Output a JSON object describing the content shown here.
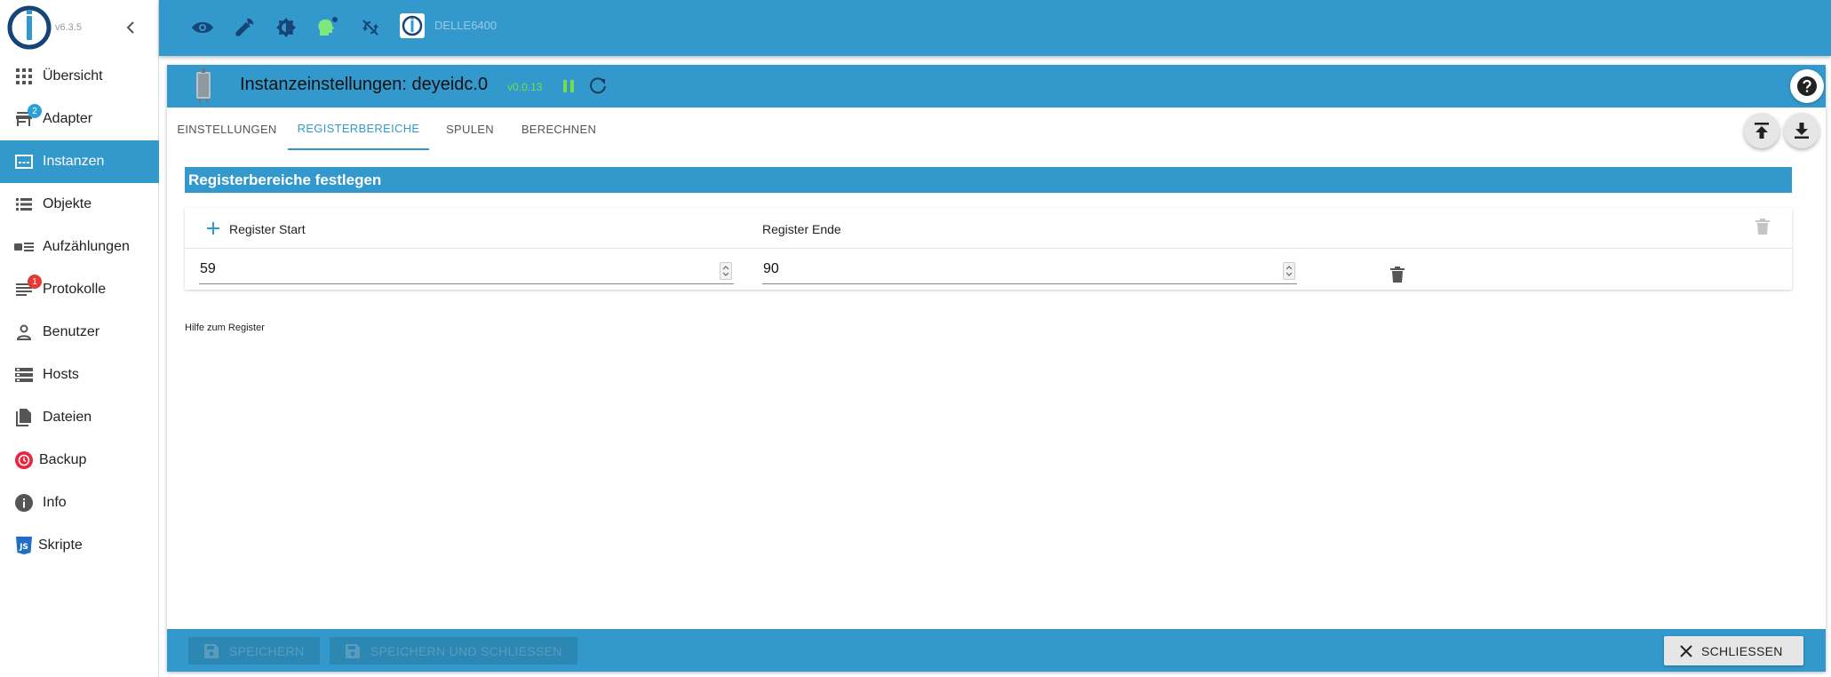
{
  "app": {
    "version": "v6.3.5",
    "host_name": "DELLE6400"
  },
  "sidebar": {
    "items": [
      {
        "label": "Übersicht",
        "icon": "grid-icon"
      },
      {
        "label": "Adapter",
        "icon": "store-icon",
        "badge": "2"
      },
      {
        "label": "Instanzen",
        "icon": "instances-icon",
        "active": true
      },
      {
        "label": "Objekte",
        "icon": "list-icon"
      },
      {
        "label": "Aufzählungen",
        "icon": "enum-icon"
      },
      {
        "label": "Protokolle",
        "icon": "log-icon",
        "badge": "1"
      },
      {
        "label": "Benutzer",
        "icon": "user-icon"
      },
      {
        "label": "Hosts",
        "icon": "hosts-icon"
      },
      {
        "label": "Dateien",
        "icon": "files-icon"
      },
      {
        "label": "Backup",
        "icon": "backup-icon"
      },
      {
        "label": "Info",
        "icon": "info-icon"
      },
      {
        "label": "Skripte",
        "icon": "js-icon"
      }
    ],
    "badge_colors": {
      "adapter": "#2b9fd8",
      "protokolle": "#e53935"
    }
  },
  "panel": {
    "title": "Instanzeinstellungen: deyeidc.0",
    "version": "v0.0.13",
    "tabs": [
      "EINSTELLUNGEN",
      "REGISTERBEREICHE",
      "SPULEN",
      "BERECHNEN"
    ],
    "active_tab": "REGISTERBEREICHE",
    "section_title": "Registerbereiche festlegen",
    "table": {
      "col_start": "Register Start",
      "col_end": "Register Ende",
      "rows": [
        {
          "start": "59",
          "end": "90"
        }
      ]
    },
    "help_text": "Hilfe zum Register",
    "footer": {
      "save": "SPEICHERN",
      "save_close": "SPEICHERN UND SCHLIESSEN",
      "close": "SCHLIESSEN"
    }
  },
  "colors": {
    "accent": "#3399cc",
    "version_green": "#6fe04a"
  }
}
